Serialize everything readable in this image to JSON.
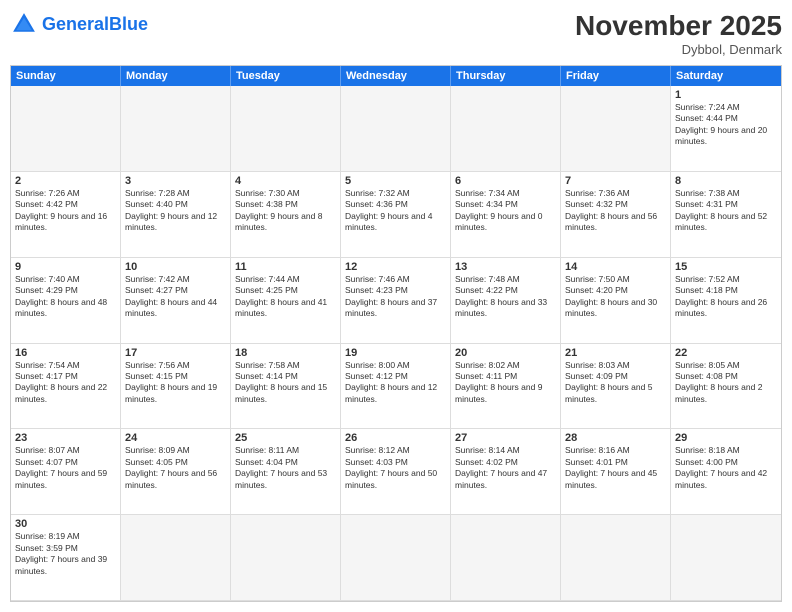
{
  "header": {
    "logo_general": "General",
    "logo_blue": "Blue",
    "month_title": "November 2025",
    "location": "Dybbol, Denmark"
  },
  "days_of_week": [
    "Sunday",
    "Monday",
    "Tuesday",
    "Wednesday",
    "Thursday",
    "Friday",
    "Saturday"
  ],
  "cells": [
    {
      "day": null,
      "empty": true
    },
    {
      "day": null,
      "empty": true
    },
    {
      "day": null,
      "empty": true
    },
    {
      "day": null,
      "empty": true
    },
    {
      "day": null,
      "empty": true
    },
    {
      "day": null,
      "empty": true
    },
    {
      "day": "1",
      "sunrise": "Sunrise: 7:24 AM",
      "sunset": "Sunset: 4:44 PM",
      "daylight": "Daylight: 9 hours and 20 minutes."
    },
    {
      "day": "2",
      "sunrise": "Sunrise: 7:26 AM",
      "sunset": "Sunset: 4:42 PM",
      "daylight": "Daylight: 9 hours and 16 minutes."
    },
    {
      "day": "3",
      "sunrise": "Sunrise: 7:28 AM",
      "sunset": "Sunset: 4:40 PM",
      "daylight": "Daylight: 9 hours and 12 minutes."
    },
    {
      "day": "4",
      "sunrise": "Sunrise: 7:30 AM",
      "sunset": "Sunset: 4:38 PM",
      "daylight": "Daylight: 9 hours and 8 minutes."
    },
    {
      "day": "5",
      "sunrise": "Sunrise: 7:32 AM",
      "sunset": "Sunset: 4:36 PM",
      "daylight": "Daylight: 9 hours and 4 minutes."
    },
    {
      "day": "6",
      "sunrise": "Sunrise: 7:34 AM",
      "sunset": "Sunset: 4:34 PM",
      "daylight": "Daylight: 9 hours and 0 minutes."
    },
    {
      "day": "7",
      "sunrise": "Sunrise: 7:36 AM",
      "sunset": "Sunset: 4:32 PM",
      "daylight": "Daylight: 8 hours and 56 minutes."
    },
    {
      "day": "8",
      "sunrise": "Sunrise: 7:38 AM",
      "sunset": "Sunset: 4:31 PM",
      "daylight": "Daylight: 8 hours and 52 minutes."
    },
    {
      "day": "9",
      "sunrise": "Sunrise: 7:40 AM",
      "sunset": "Sunset: 4:29 PM",
      "daylight": "Daylight: 8 hours and 48 minutes."
    },
    {
      "day": "10",
      "sunrise": "Sunrise: 7:42 AM",
      "sunset": "Sunset: 4:27 PM",
      "daylight": "Daylight: 8 hours and 44 minutes."
    },
    {
      "day": "11",
      "sunrise": "Sunrise: 7:44 AM",
      "sunset": "Sunset: 4:25 PM",
      "daylight": "Daylight: 8 hours and 41 minutes."
    },
    {
      "day": "12",
      "sunrise": "Sunrise: 7:46 AM",
      "sunset": "Sunset: 4:23 PM",
      "daylight": "Daylight: 8 hours and 37 minutes."
    },
    {
      "day": "13",
      "sunrise": "Sunrise: 7:48 AM",
      "sunset": "Sunset: 4:22 PM",
      "daylight": "Daylight: 8 hours and 33 minutes."
    },
    {
      "day": "14",
      "sunrise": "Sunrise: 7:50 AM",
      "sunset": "Sunset: 4:20 PM",
      "daylight": "Daylight: 8 hours and 30 minutes."
    },
    {
      "day": "15",
      "sunrise": "Sunrise: 7:52 AM",
      "sunset": "Sunset: 4:18 PM",
      "daylight": "Daylight: 8 hours and 26 minutes."
    },
    {
      "day": "16",
      "sunrise": "Sunrise: 7:54 AM",
      "sunset": "Sunset: 4:17 PM",
      "daylight": "Daylight: 8 hours and 22 minutes."
    },
    {
      "day": "17",
      "sunrise": "Sunrise: 7:56 AM",
      "sunset": "Sunset: 4:15 PM",
      "daylight": "Daylight: 8 hours and 19 minutes."
    },
    {
      "day": "18",
      "sunrise": "Sunrise: 7:58 AM",
      "sunset": "Sunset: 4:14 PM",
      "daylight": "Daylight: 8 hours and 15 minutes."
    },
    {
      "day": "19",
      "sunrise": "Sunrise: 8:00 AM",
      "sunset": "Sunset: 4:12 PM",
      "daylight": "Daylight: 8 hours and 12 minutes."
    },
    {
      "day": "20",
      "sunrise": "Sunrise: 8:02 AM",
      "sunset": "Sunset: 4:11 PM",
      "daylight": "Daylight: 8 hours and 9 minutes."
    },
    {
      "day": "21",
      "sunrise": "Sunrise: 8:03 AM",
      "sunset": "Sunset: 4:09 PM",
      "daylight": "Daylight: 8 hours and 5 minutes."
    },
    {
      "day": "22",
      "sunrise": "Sunrise: 8:05 AM",
      "sunset": "Sunset: 4:08 PM",
      "daylight": "Daylight: 8 hours and 2 minutes."
    },
    {
      "day": "23",
      "sunrise": "Sunrise: 8:07 AM",
      "sunset": "Sunset: 4:07 PM",
      "daylight": "Daylight: 7 hours and 59 minutes."
    },
    {
      "day": "24",
      "sunrise": "Sunrise: 8:09 AM",
      "sunset": "Sunset: 4:05 PM",
      "daylight": "Daylight: 7 hours and 56 minutes."
    },
    {
      "day": "25",
      "sunrise": "Sunrise: 8:11 AM",
      "sunset": "Sunset: 4:04 PM",
      "daylight": "Daylight: 7 hours and 53 minutes."
    },
    {
      "day": "26",
      "sunrise": "Sunrise: 8:12 AM",
      "sunset": "Sunset: 4:03 PM",
      "daylight": "Daylight: 7 hours and 50 minutes."
    },
    {
      "day": "27",
      "sunrise": "Sunrise: 8:14 AM",
      "sunset": "Sunset: 4:02 PM",
      "daylight": "Daylight: 7 hours and 47 minutes."
    },
    {
      "day": "28",
      "sunrise": "Sunrise: 8:16 AM",
      "sunset": "Sunset: 4:01 PM",
      "daylight": "Daylight: 7 hours and 45 minutes."
    },
    {
      "day": "29",
      "sunrise": "Sunrise: 8:18 AM",
      "sunset": "Sunset: 4:00 PM",
      "daylight": "Daylight: 7 hours and 42 minutes."
    },
    {
      "day": "30",
      "sunrise": "Sunrise: 8:19 AM",
      "sunset": "Sunset: 3:59 PM",
      "daylight": "Daylight: 7 hours and 39 minutes."
    },
    {
      "day": null,
      "empty": true
    },
    {
      "day": null,
      "empty": true
    },
    {
      "day": null,
      "empty": true
    },
    {
      "day": null,
      "empty": true
    },
    {
      "day": null,
      "empty": true
    },
    {
      "day": null,
      "empty": true
    }
  ]
}
